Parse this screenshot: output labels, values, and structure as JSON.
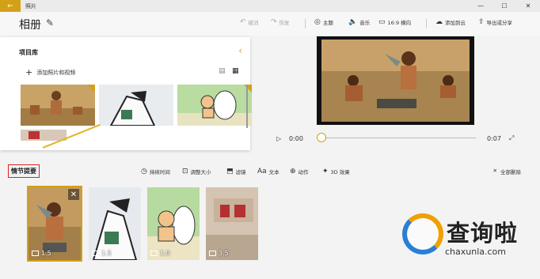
{
  "window": {
    "app_title": "照片",
    "back_icon": "back-arrow-icon",
    "controls": [
      "minimize-icon",
      "maximize-icon",
      "close-icon"
    ]
  },
  "toolbar": {
    "album_title": "相册",
    "undo": "撤消",
    "redo": "恢复",
    "theme": "主题",
    "music": "音乐",
    "aspect": "16:9 横向",
    "add_cloud": "添加到云",
    "export": "导出或分享"
  },
  "library": {
    "title": "项目库",
    "add_label": "添加照片和视频"
  },
  "player": {
    "time_start": "0:00",
    "time_end": "0:07",
    "progress": 0.0
  },
  "storyboard": {
    "title": "情节提要",
    "tools": {
      "duration": "持续时间",
      "resize": "调整大小",
      "filter": "滤镜",
      "text": "文本",
      "motion": "动作",
      "effects3d": "3D 效果"
    },
    "delete_all": "全部删除",
    "cards": [
      {
        "duration": "1.5",
        "selected": true
      },
      {
        "duration": "1.5",
        "selected": false
      },
      {
        "duration": "1.0",
        "selected": false
      },
      {
        "duration": "3.5",
        "selected": false
      }
    ]
  },
  "watermark": {
    "text": "查询啦",
    "sub": "chaxunla.com"
  },
  "colors": {
    "accent": "#d4a017",
    "highlight_box": "#dd2222"
  }
}
